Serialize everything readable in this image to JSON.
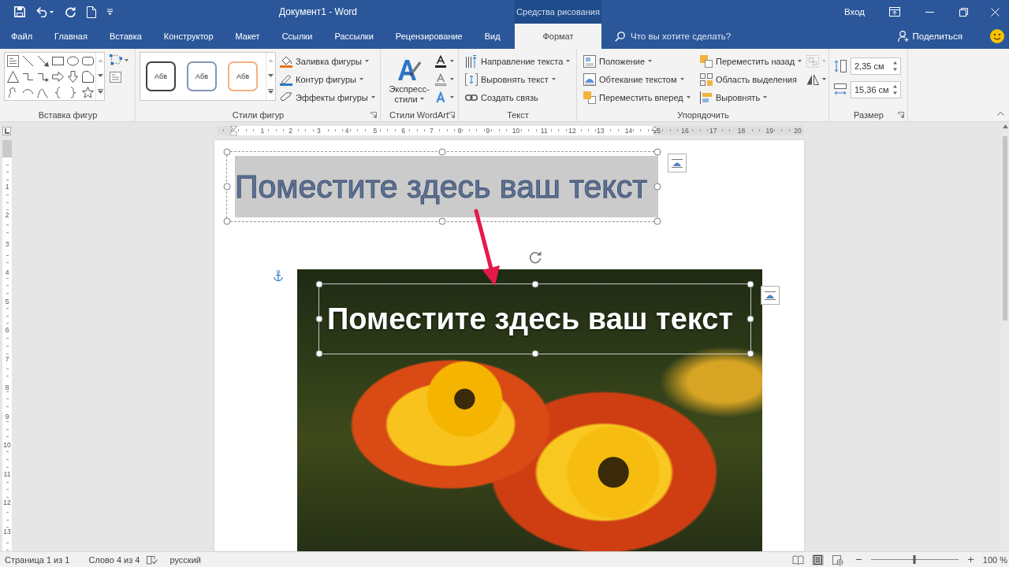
{
  "title_bar": {
    "title": "Документ1 - Word",
    "context_label": "Средства рисования",
    "sign_in": "Вход"
  },
  "tabs": [
    {
      "label": "Файл",
      "kind": "standard",
      "selected": false
    },
    {
      "label": "Главная",
      "kind": "standard",
      "selected": false
    },
    {
      "label": "Вставка",
      "kind": "standard",
      "selected": false
    },
    {
      "label": "Конструктор",
      "kind": "standard",
      "selected": false
    },
    {
      "label": "Макет",
      "kind": "standard",
      "selected": false
    },
    {
      "label": "Ссылки",
      "kind": "standard",
      "selected": false
    },
    {
      "label": "Рассылки",
      "kind": "standard",
      "selected": false
    },
    {
      "label": "Рецензирование",
      "kind": "standard",
      "selected": false
    },
    {
      "label": "Вид",
      "kind": "standard",
      "selected": false
    },
    {
      "label": "Формат",
      "kind": "contextual",
      "selected": true
    }
  ],
  "search": {
    "placeholder": "Что вы хотите сделать?"
  },
  "share": {
    "label": "Поделиться"
  },
  "ribbon": {
    "groups": [
      {
        "kind": "shapes",
        "label": "Вставка фигур",
        "launcher": false
      },
      {
        "kind": "styles",
        "label": "Стили фигур",
        "launcher": true,
        "gallery": [
          {
            "label": "Абв",
            "color": "#404040"
          },
          {
            "label": "Абв",
            "color": "#8497b0"
          },
          {
            "label": "Абв",
            "color": "#f4b183"
          }
        ],
        "commands": [
          {
            "label": "Заливка фигуры",
            "dropdown": true
          },
          {
            "label": "Контур фигуры",
            "dropdown": true
          },
          {
            "label": "Эффекты фигуры",
            "dropdown": true
          }
        ]
      },
      {
        "kind": "wordart",
        "label": "Стили WordArt",
        "launcher": true,
        "quick_styles": "Экспресс-стили"
      },
      {
        "kind": "text",
        "label": "Текст",
        "launcher": false,
        "commands": [
          {
            "label": "Направление текста",
            "dropdown": true
          },
          {
            "label": "Выровнять текст",
            "dropdown": true
          },
          {
            "label": "Создать связь",
            "dropdown": false
          }
        ]
      },
      {
        "kind": "arrange",
        "label": "Упорядочить",
        "launcher": false,
        "commands": [
          {
            "label": "Положение",
            "dropdown": true
          },
          {
            "label": "Обтекание текстом",
            "dropdown": true
          },
          {
            "label": "Переместить вперед",
            "dropdown": true
          },
          {
            "label": "Переместить назад",
            "dropdown": true
          },
          {
            "label": "Область выделения",
            "dropdown": false
          },
          {
            "label": "Выровнять",
            "dropdown": true
          }
        ],
        "tools": [
          {
            "disabled": true
          },
          {
            "disabled": false
          }
        ]
      },
      {
        "kind": "size",
        "label": "Размер",
        "launcher": true,
        "fields": [
          {
            "value": "2,35 см"
          },
          {
            "value": "15,36 см"
          }
        ]
      }
    ]
  },
  "rulers": {
    "horizontal": [
      "1",
      "2",
      "3",
      "4",
      "5",
      "6",
      "7",
      "8",
      "9",
      "10",
      "11",
      "12",
      "13",
      "14",
      "15",
      "16",
      "17",
      "18",
      "19",
      "20"
    ],
    "vertical": [
      "1",
      "2",
      "3",
      "4",
      "5",
      "6",
      "7",
      "8",
      "9",
      "10",
      "11",
      "12",
      "13"
    ]
  },
  "document": {
    "wordart_box": {
      "text": "Поместите здесь ваш текст",
      "selected": true
    },
    "picture": {
      "text_box": {
        "text": "Поместите здесь ваш текст",
        "selected": true
      }
    }
  },
  "status_bar": {
    "page": "Страница 1 из 1",
    "words": "Слово 4 из 4",
    "language": "русский",
    "views": [
      {
        "selected": false
      },
      {
        "selected": true
      },
      {
        "selected": false
      }
    ],
    "zoom": {
      "level": 0.5,
      "reading": "100 %"
    }
  }
}
